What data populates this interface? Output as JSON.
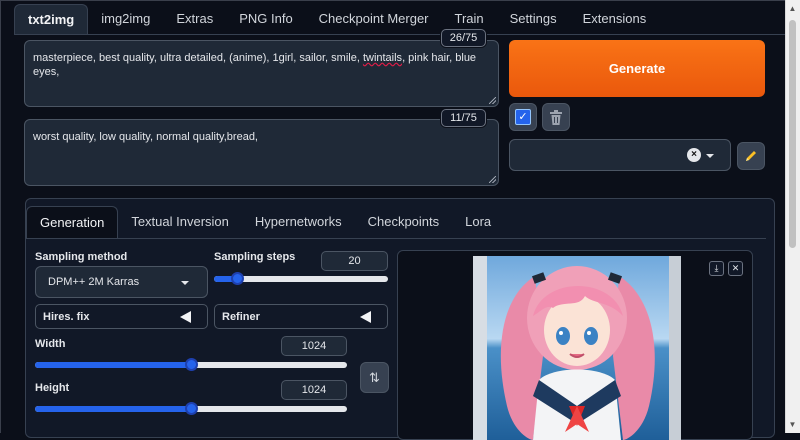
{
  "tabs": [
    {
      "label": "txt2img",
      "active": true
    },
    {
      "label": "img2img"
    },
    {
      "label": "Extras"
    },
    {
      "label": "PNG Info"
    },
    {
      "label": "Checkpoint Merger"
    },
    {
      "label": "Train"
    },
    {
      "label": "Settings"
    },
    {
      "label": "Extensions"
    }
  ],
  "prompt": {
    "text_before": "masterpiece, best quality, ultra detailed, (anime), 1girl, sailor, smile, ",
    "text_misspelled": "twintails",
    "text_after": ", pink hair, blue eyes,",
    "token_count": "26/75"
  },
  "negative_prompt": {
    "text": "worst quality, low quality, normal quality,bread,",
    "token_count": "11/75"
  },
  "generate_label": "Generate",
  "colors": {
    "generate": "#f97316",
    "accent": "#2563eb",
    "background": "#0b0f19"
  },
  "subtabs": [
    {
      "label": "Generation",
      "active": true
    },
    {
      "label": "Textual Inversion"
    },
    {
      "label": "Hypernetworks"
    },
    {
      "label": "Checkpoints"
    },
    {
      "label": "Lora"
    }
  ],
  "sampling_method": {
    "label": "Sampling method",
    "value": "DPM++ 2M Karras"
  },
  "sampling_steps": {
    "label": "Sampling steps",
    "value": "20",
    "level": 0.13
  },
  "hires_fix": {
    "label": "Hires. fix"
  },
  "refiner": {
    "label": "Refiner"
  },
  "width": {
    "label": "Width",
    "value": "1024",
    "level": 0.5
  },
  "height": {
    "label": "Height",
    "value": "1024",
    "level": 0.5
  },
  "icons": {
    "swap": "swap-dimensions-icon",
    "trash": "trash-icon",
    "edit": "pencil-icon",
    "download": "download-icon",
    "close": "close-icon"
  }
}
